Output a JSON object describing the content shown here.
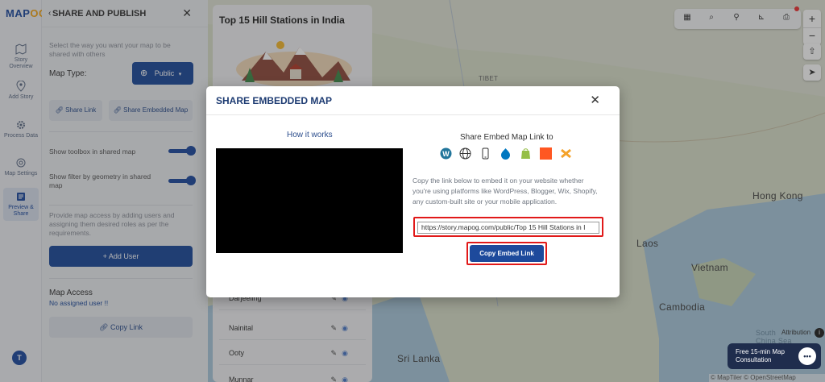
{
  "app": {
    "logo_text": "MAPOG",
    "logo_main": "MAP",
    "logo_accent": "OG"
  },
  "rail": {
    "items": [
      {
        "label": "Story Overview",
        "icon": "map-icon"
      },
      {
        "label": "Add Story",
        "icon": "location-pin-icon"
      },
      {
        "label": "Process Data",
        "icon": "gear-icon"
      },
      {
        "label": "Map Settings",
        "icon": "settings-icon"
      },
      {
        "label": "Preview & Share",
        "icon": "share-icon"
      }
    ],
    "avatar": "T"
  },
  "share_panel": {
    "title": "SHARE AND PUBLISH",
    "description": "Select the way you want your map to be shared with others",
    "map_type_label": "Map Type:",
    "map_type_value": "Public",
    "share_link_label": "Share Link",
    "share_embedded_label": "Share Embedded Map",
    "toggle_toolbox_label": "Show toolbox in shared map",
    "toggle_filter_label": "Show filter by geometry in shared map",
    "access_help": "Provide map access by adding users and assigning them desired roles as per the requirements.",
    "add_user_label": "+ Add User",
    "map_access_title": "Map Access",
    "no_user_text": "No assigned user !!",
    "copy_link_label": "Copy Link"
  },
  "story_card": {
    "title": "Top 15 Hill Stations in India",
    "places": [
      "Darjeeling",
      "Nainital",
      "Ooty",
      "Munnar"
    ]
  },
  "modal": {
    "title": "SHARE EMBEDDED MAP",
    "how_it_works": "How it works",
    "share_title": "Share Embed Map Link to",
    "platforms": [
      "wordpress-icon",
      "globe-icon",
      "mobile-icon",
      "drupal-icon",
      "shopify-icon",
      "blogger-icon",
      "joomla-icon"
    ],
    "description": "Copy the link below to embed it on your website whether you're using platforms like WordPress, Blogger, Wix, Shopify, any custom-built site or your mobile application.",
    "embed_url": "https://story.mapog.com/public/Top 15 Hill Stations in I",
    "copy_button": "Copy Embed Link"
  },
  "map": {
    "labels": {
      "hong_kong": "Hong Kong",
      "laos": "Laos",
      "vietnam": "Vietnam",
      "cambodia": "Cambodia",
      "sri_lanka": "Sri Lanka",
      "tibet": "TIBET",
      "south_china_sea": "South China Sea"
    },
    "attribution": "Attribution",
    "credits": "© MapTiler © OpenStreetMap contributors",
    "consult_text": "Free 15-min Map Consultation"
  },
  "colors": {
    "primary": "#1d4a9c",
    "highlight": "#e11919",
    "accent": "#f2a51a"
  }
}
